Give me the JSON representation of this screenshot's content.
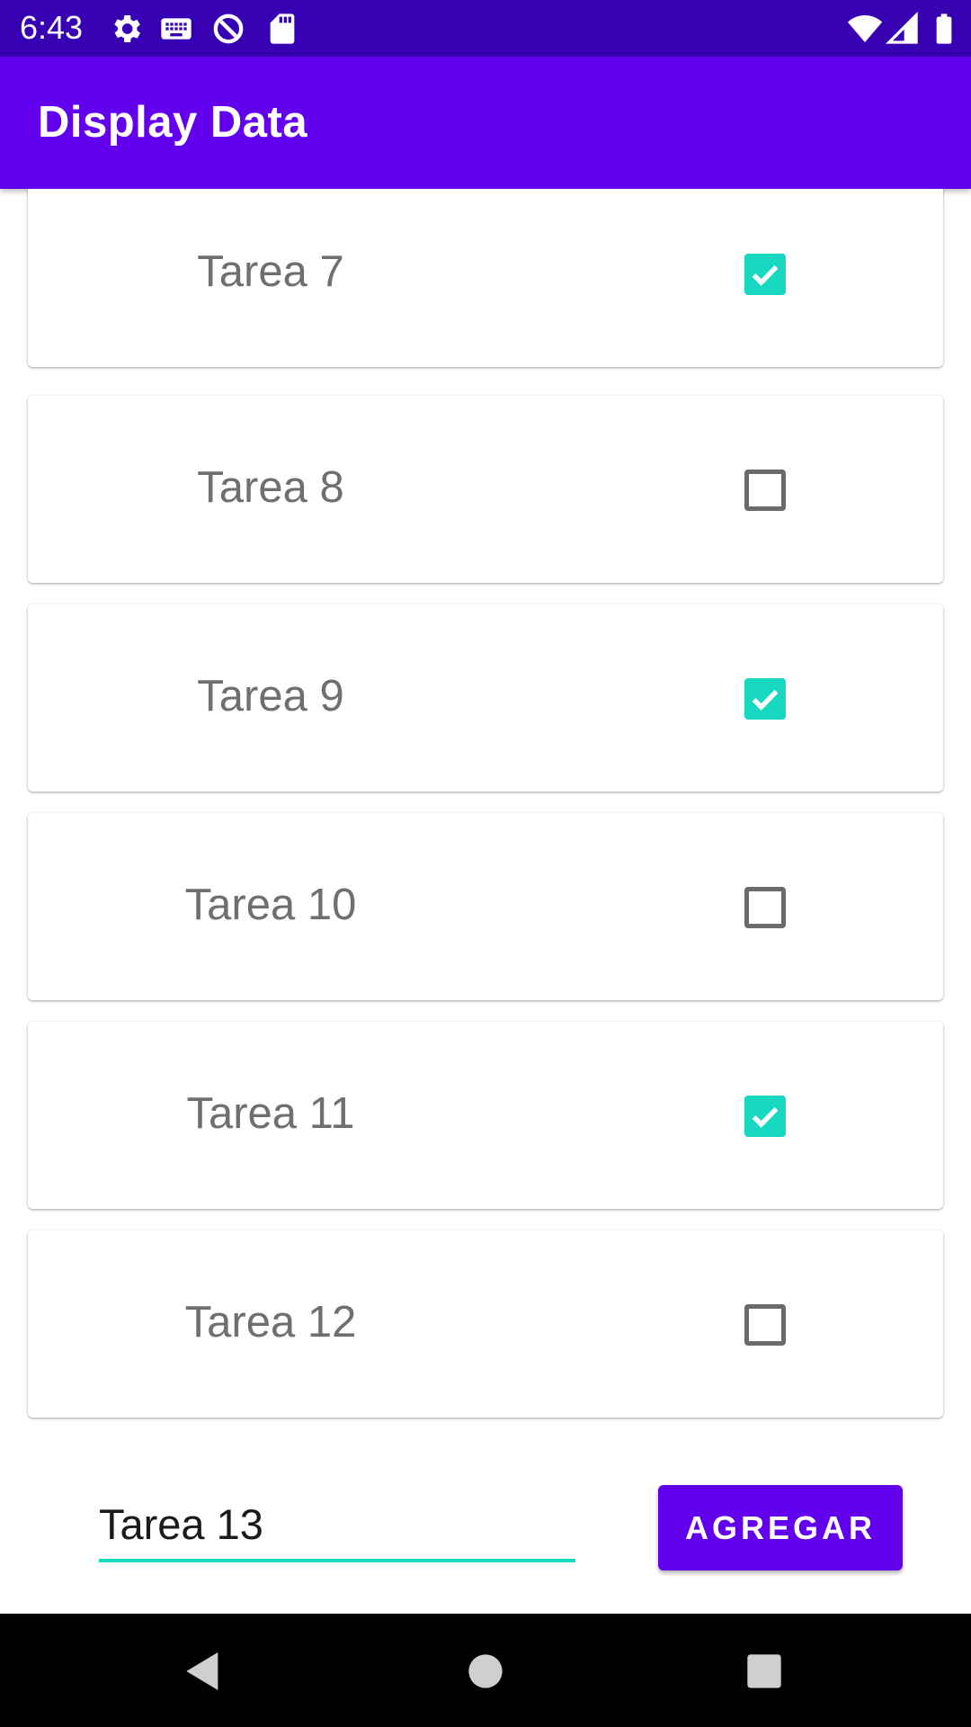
{
  "status_bar": {
    "time": "6:43",
    "left_icons": [
      "gear-icon",
      "keyboard-icon",
      "data-saver-icon",
      "sd-card-icon"
    ],
    "right_icons": [
      "wifi-icon",
      "signal-icon",
      "battery-icon"
    ]
  },
  "app_bar": {
    "title": "Display Data"
  },
  "tasks": [
    {
      "label": "Tarea 7",
      "checked": true
    },
    {
      "label": "Tarea 8",
      "checked": false
    },
    {
      "label": "Tarea 9",
      "checked": true
    },
    {
      "label": "Tarea 10",
      "checked": false
    },
    {
      "label": "Tarea 11",
      "checked": true
    },
    {
      "label": "Tarea 12",
      "checked": false
    }
  ],
  "new_task": {
    "value": "Tarea 13"
  },
  "add_button": {
    "label": "AGREGAR"
  },
  "nav_bar": {
    "icons": [
      "back-icon",
      "home-icon",
      "recents-icon"
    ]
  },
  "colors": {
    "status_bar": "#3700b3",
    "primary": "#6200ee",
    "accent": "#18d8c2"
  }
}
